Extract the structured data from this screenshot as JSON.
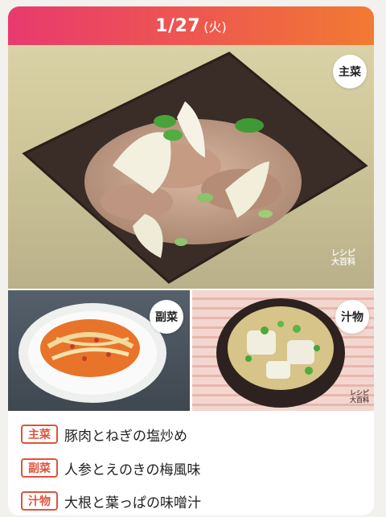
{
  "header": {
    "date": "1/27",
    "weekday": "(火)"
  },
  "photos": {
    "main": {
      "badge": "主菜",
      "watermark_line1": "レシピ",
      "watermark_line2": "大百科"
    },
    "side": {
      "badge": "副菜"
    },
    "soup": {
      "badge": "汁物",
      "watermark_line1": "レシピ",
      "watermark_line2": "大百科"
    }
  },
  "menu": [
    {
      "category": "主菜",
      "dish": "豚肉とねぎの塩炒め"
    },
    {
      "category": "副菜",
      "dish": "人参とえのきの梅風味"
    },
    {
      "category": "汁物",
      "dish": "大根と葉っぱの味噌汁"
    }
  ],
  "colors": {
    "accent": "#e0533e",
    "header_start": "#e83a6e",
    "header_end": "#f27a32"
  }
}
